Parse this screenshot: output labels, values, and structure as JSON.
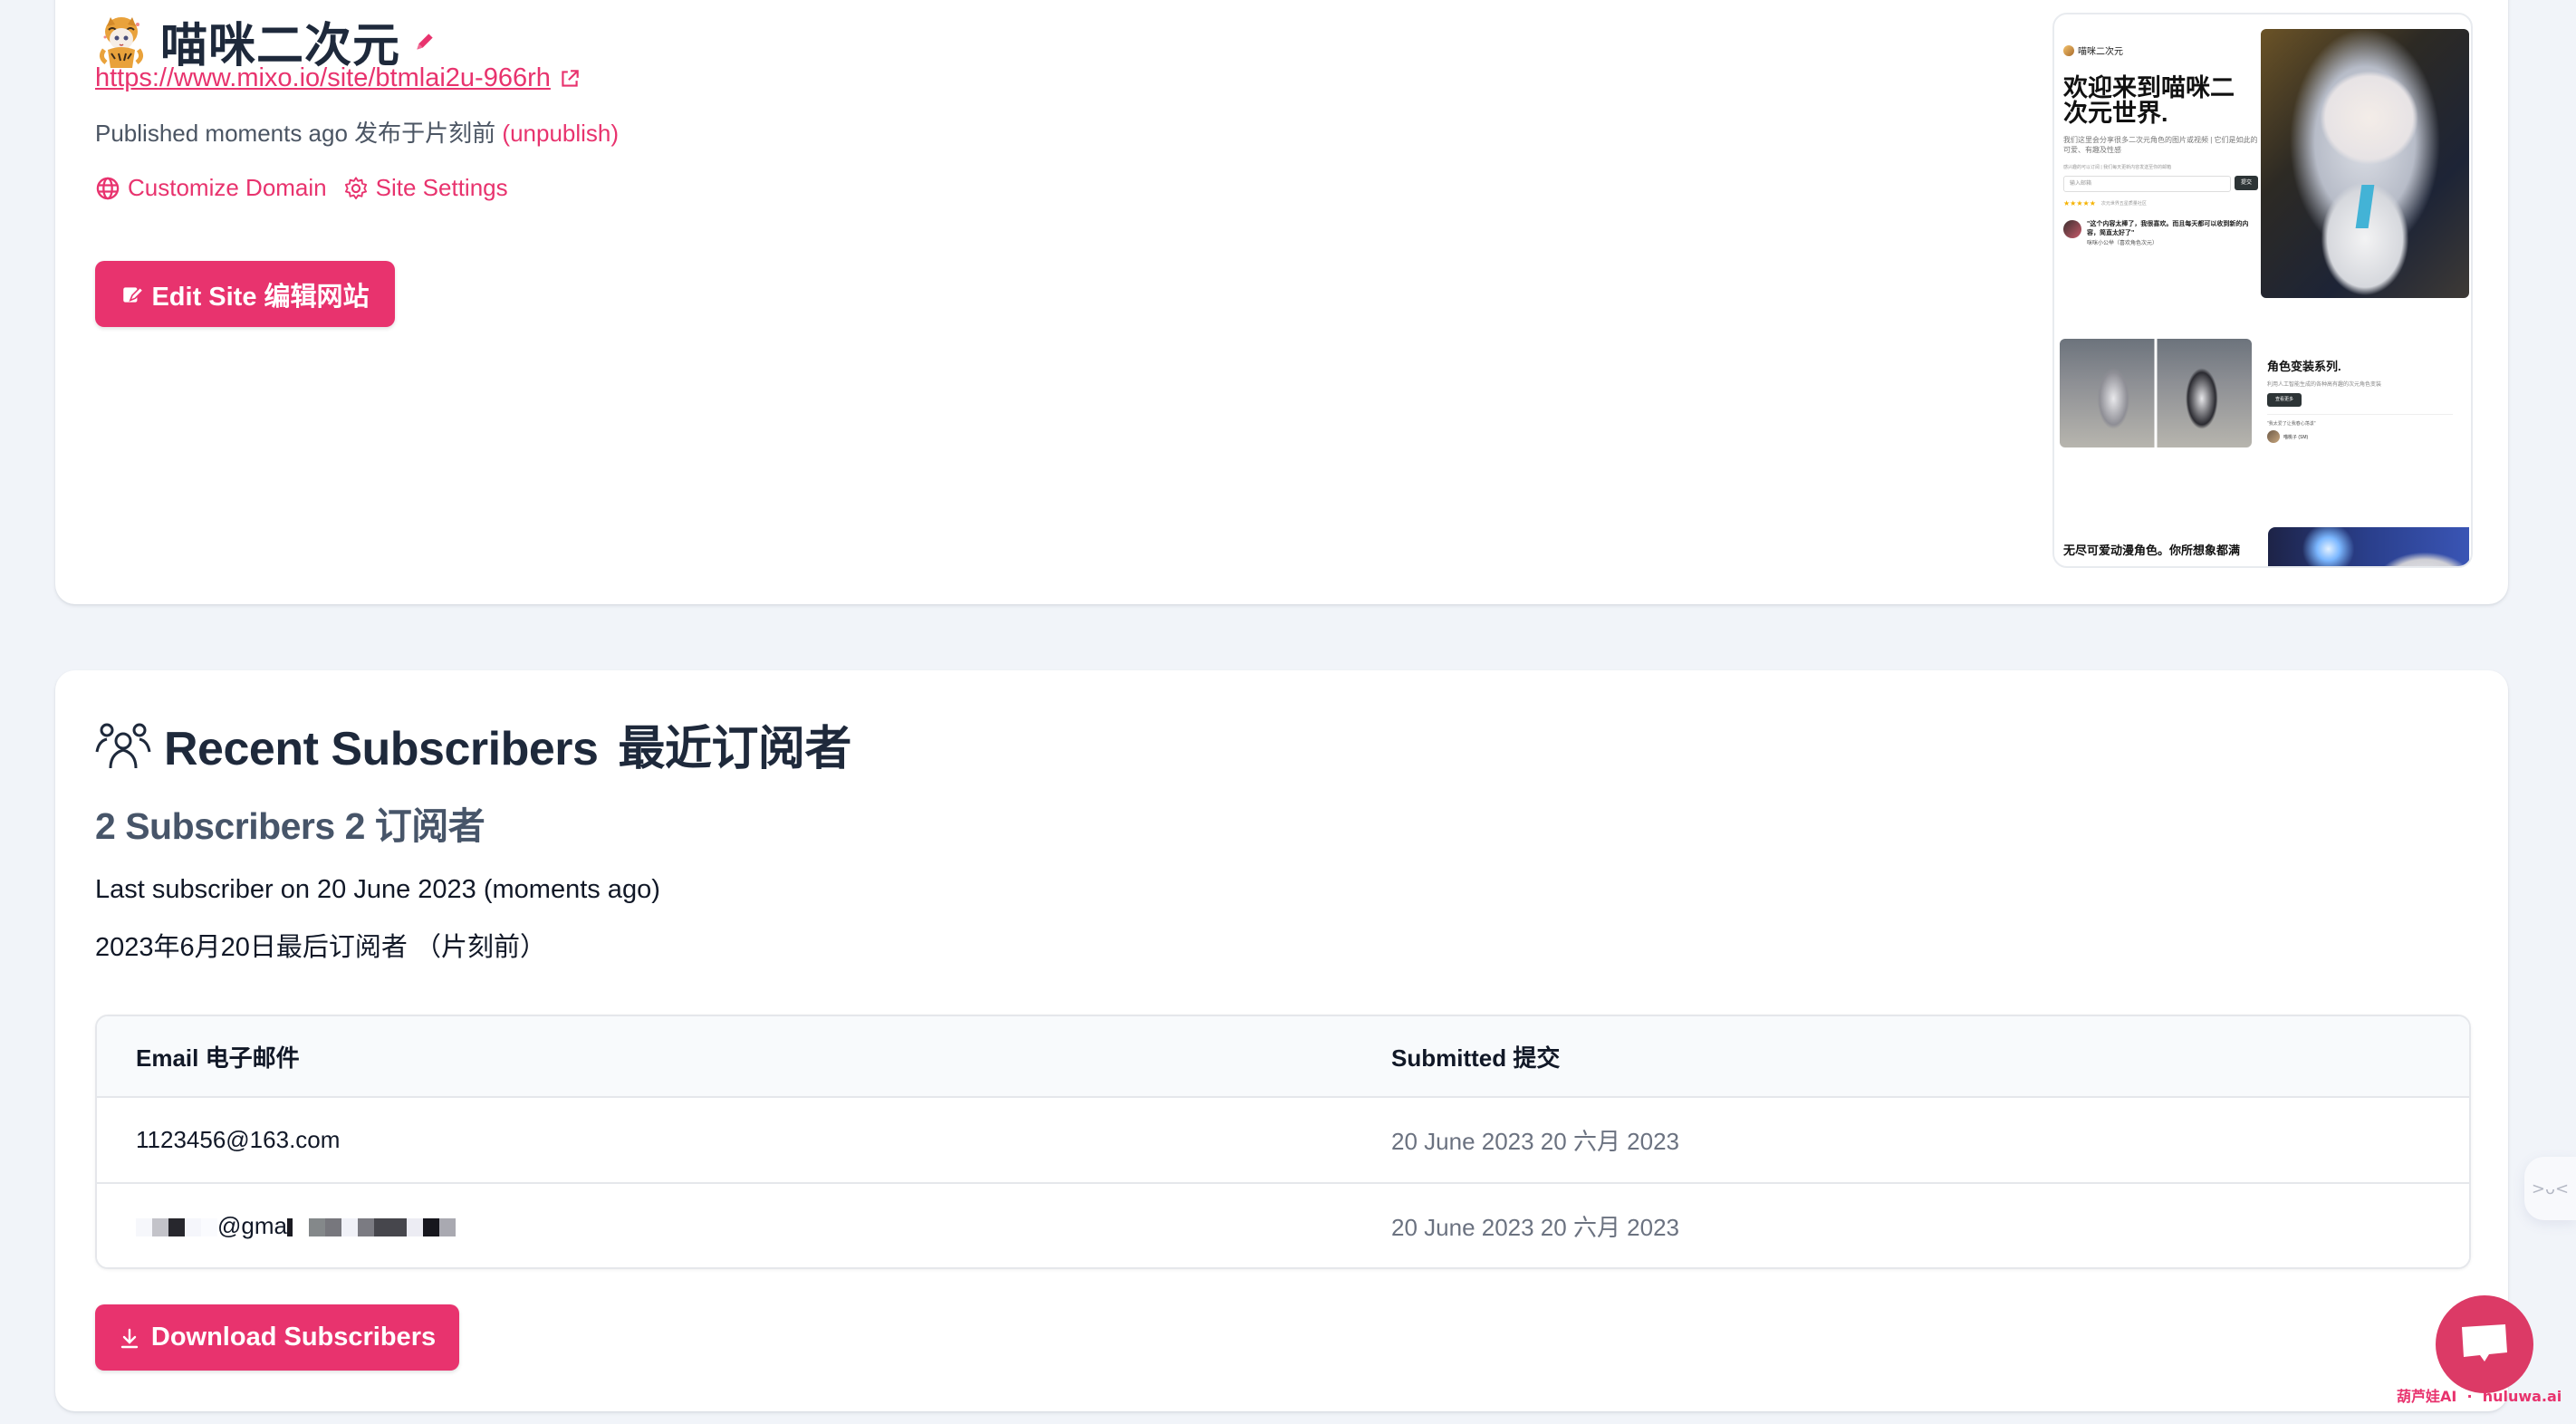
{
  "site": {
    "title": "喵咪二次元",
    "url": "https://www.mixo.io/site/btmlai2u-966rh",
    "published_text": "Published moments ago 发布于片刻前",
    "unpublish_label": "(unpublish)",
    "customize_domain_label": "Customize Domain",
    "site_settings_label": "Site Settings",
    "edit_button_label": "Edit Site 编辑网站",
    "icons": {
      "avatar": "tiger-girl-avatar",
      "edit_title": "pencil-icon",
      "url": "external-link-icon",
      "domain": "globe-icon",
      "settings": "gear-icon",
      "edit_button": "edit-icon"
    },
    "preview": {
      "brand": "喵咪二次元",
      "headline": "欢迎来到喵咪二次元世界.",
      "subtitle": "我们这里会分享很多二次元角色的图片或视频 | 它们是如此的可爱、有趣及性感",
      "note": "感兴趣的可以订阅 | 我们每天更新内容发送至你的邮箱",
      "input_placeholder": "输入邮箱",
      "submit_label": "提交",
      "stars": "★★★★★",
      "rating_text": "次元世界五星质量社区",
      "quote": "\"这个内容太棒了，我很喜欢。而且每天都可以收到新的内容，简直太好了\"",
      "quote_author": "咪咪小公举（喜欢角色次元）",
      "section_title": "角色变装系列.",
      "section_subtitle": "利用人工智能生成的各种高有趣的次元角色变装",
      "section_button": "查看更多",
      "section_quote": "\"我太爱了让我春心荡漾\"",
      "section_author": "喵桃子 (SM)",
      "bottom_heading": "无尽可爱动漫角色。你所想象都满"
    }
  },
  "subscribers": {
    "title": "Recent Subscribers",
    "title_cn": "最近订阅者",
    "title_icon": "users-icon",
    "count_text": "2 Subscribers 2 订阅者",
    "last_subscriber_text": "Last subscriber on 20 June 2023 (moments ago)",
    "last_subscriber_text_cn": "2023年6月20日最后订阅者 （片刻前）",
    "table": {
      "headers": [
        "Email  电子邮件",
        "Submitted  提交"
      ],
      "rows": [
        {
          "email": "1123456@163.com",
          "submitted": "20 June 2023 20 六月 2023"
        },
        {
          "email": "@gma",
          "email_redacted": true,
          "submitted": "20 June 2023 20 六月 2023"
        }
      ]
    },
    "download_label": "Download Subscribers",
    "download_icon": "download-icon"
  },
  "floating": {
    "side_widget_text": ">ᴗ<",
    "chat_icon": "chat-bubble-icon",
    "watermark": "葫芦娃AI  ·  huluwa.ai"
  },
  "colors": {
    "accent": "#e8336e",
    "background": "#f1f4f9",
    "card": "#ffffff",
    "heading": "#1e293b",
    "muted": "#6b7280",
    "chat_bubble": "#dc3a66"
  }
}
